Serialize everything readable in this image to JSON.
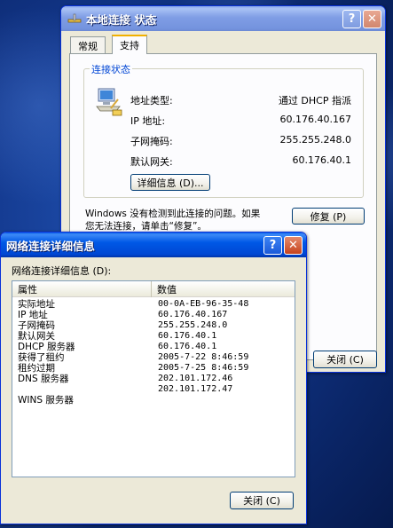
{
  "status_window": {
    "title": "本地连接 状态",
    "tabs": [
      {
        "label": "常规"
      },
      {
        "label": "支持"
      }
    ],
    "group_title": "连接状态",
    "fields": [
      {
        "label": "地址类型:",
        "value": "通过 DHCP 指派"
      },
      {
        "label": "IP 地址:",
        "value": "60.176.40.167"
      },
      {
        "label": "子网掩码:",
        "value": "255.255.248.0"
      },
      {
        "label": "默认网关:",
        "value": "60.176.40.1"
      }
    ],
    "details_button": "详细信息 (D)...",
    "message": [
      "Windows 没有检测到此连接的问题。如果",
      "您无法连接，请单击“修复”。"
    ],
    "repair_button": "修复 (P)",
    "close_button": "关闭 (C)"
  },
  "details_window": {
    "title": "网络连接详细信息",
    "list_label": "网络连接详细信息 (D):",
    "columns": [
      "属性",
      "数值"
    ],
    "rows": [
      {
        "property": "实际地址",
        "value": "00-0A-EB-96-35-48"
      },
      {
        "property": "IP 地址",
        "value": "60.176.40.167"
      },
      {
        "property": "子网掩码",
        "value": "255.255.248.0"
      },
      {
        "property": "默认网关",
        "value": "60.176.40.1"
      },
      {
        "property": "DHCP 服务器",
        "value": "60.176.40.1"
      },
      {
        "property": "获得了租约",
        "value": "2005-7-22 8:46:59"
      },
      {
        "property": "租约过期",
        "value": "2005-7-25 8:46:59"
      },
      {
        "property": "DNS 服务器",
        "value": "202.101.172.46"
      },
      {
        "property": "",
        "value": "202.101.172.47"
      },
      {
        "property": "WINS 服务器",
        "value": ""
      }
    ],
    "close_button": "关闭 (C)"
  },
  "titlebar_buttons": {
    "help": "?",
    "close": "✕"
  }
}
